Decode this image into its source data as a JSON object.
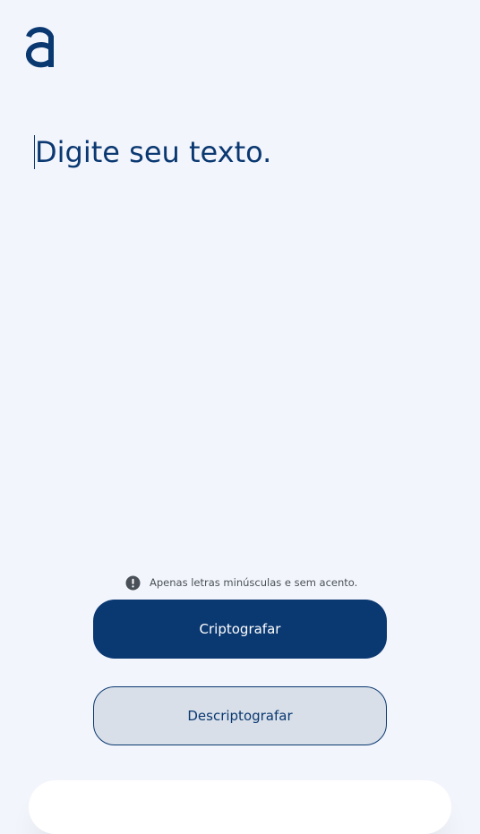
{
  "logo": {
    "icon": "alura-logo-icon",
    "color": "#0a3871"
  },
  "input": {
    "placeholder": "Digite seu texto.",
    "value": ""
  },
  "hint": {
    "icon": "exclamation-circle-icon",
    "text": "Apenas letras minúsculas e sem acento."
  },
  "buttons": {
    "encrypt_label": "Criptografar",
    "decrypt_label": "Descriptografar"
  },
  "colors": {
    "background": "#f3f5fc",
    "primary": "#0a3871",
    "secondary_button_bg": "#d8dfe8",
    "hint_text": "#495057"
  }
}
